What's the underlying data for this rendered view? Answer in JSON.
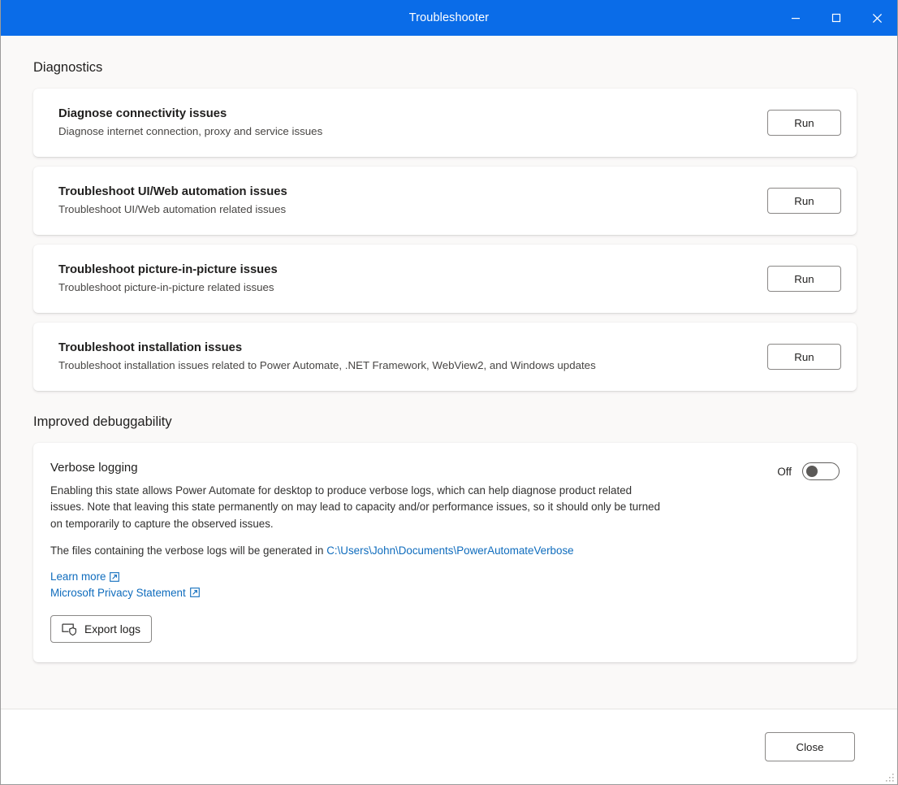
{
  "window": {
    "title": "Troubleshooter",
    "controls": [
      {
        "name": "minimize",
        "label": "Minimize"
      },
      {
        "name": "maximize",
        "label": "Maximize"
      },
      {
        "name": "close",
        "label": "Close"
      }
    ]
  },
  "sections": {
    "diagnostics": {
      "heading": "Diagnostics",
      "items": [
        {
          "title": "Diagnose connectivity issues",
          "description": "Diagnose internet connection, proxy and service issues",
          "action": "Run"
        },
        {
          "title": "Troubleshoot UI/Web automation issues",
          "description": "Troubleshoot UI/Web automation related issues",
          "action": "Run"
        },
        {
          "title": "Troubleshoot picture-in-picture issues",
          "description": "Troubleshoot picture-in-picture related issues",
          "action": "Run"
        },
        {
          "title": "Troubleshoot installation issues",
          "description": "Troubleshoot installation issues related to Power Automate, .NET Framework, WebView2, and Windows updates",
          "action": "Run"
        }
      ]
    },
    "debuggability": {
      "heading": "Improved debuggability",
      "verbose_logging": {
        "title": "Verbose logging",
        "description": "Enabling this state allows Power Automate for desktop to produce verbose logs, which can help diagnose product related issues. Note that leaving this state permanently on may lead to capacity and/or performance issues, so it should only be turned on temporarily to capture the observed issues.",
        "path_prefix": "The files containing the verbose logs will be generated in ",
        "path_value": "C:\\Users\\John\\Documents\\PowerAutomateVerbose",
        "toggle_state_label": "Off",
        "toggle_on": false,
        "links": [
          {
            "label": "Learn more",
            "icon": "external-link-icon"
          },
          {
            "label": "Microsoft Privacy Statement",
            "icon": "external-link-icon"
          }
        ],
        "export_button": "Export logs"
      }
    }
  },
  "footer": {
    "close_label": "Close"
  },
  "colors": {
    "titlebar": "#0a6ce8",
    "content_bg": "#faf9f8",
    "card_bg": "#ffffff",
    "link": "#0f6cbd",
    "text_primary": "#201f1e",
    "text_secondary": "#484644"
  }
}
